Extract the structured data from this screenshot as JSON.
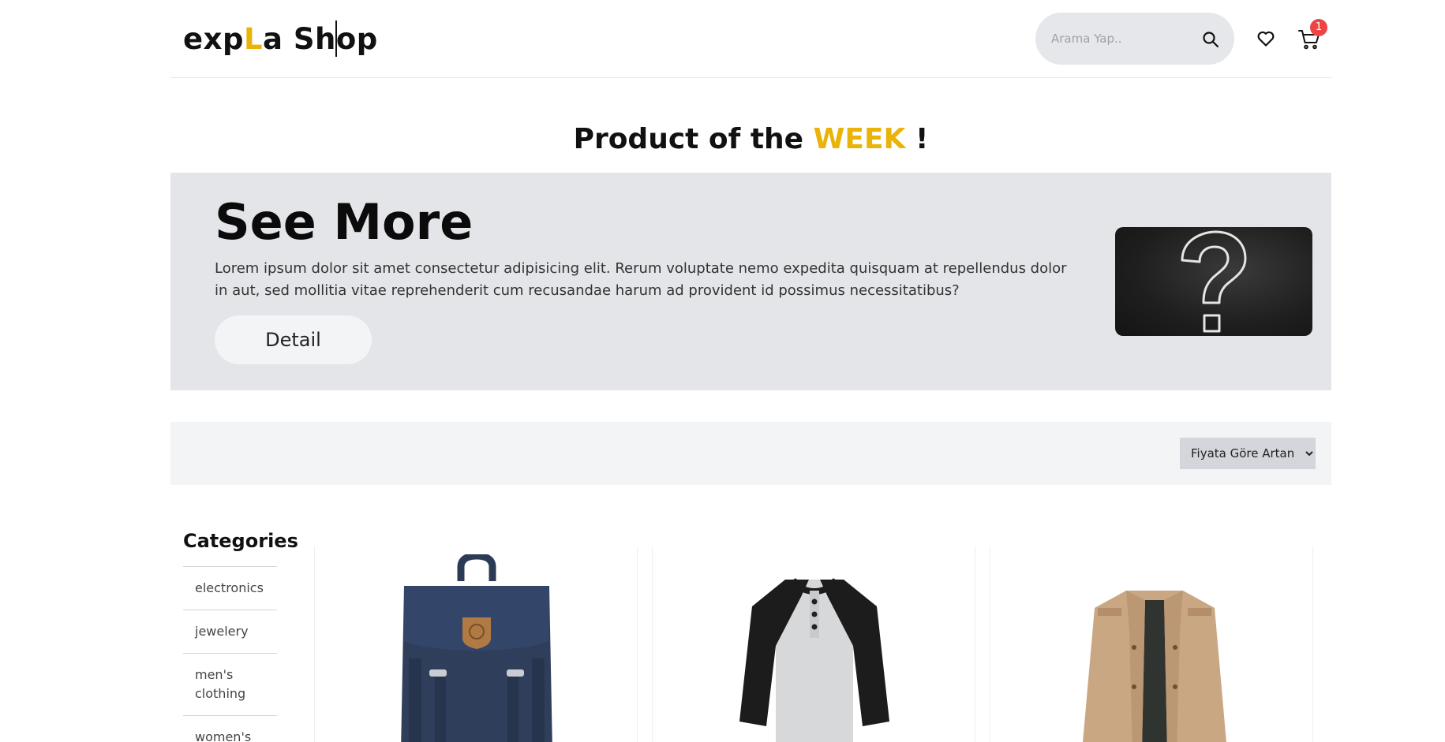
{
  "header": {
    "logo": {
      "part1": "exp",
      "accent": "L",
      "part2": "a Sh",
      "part3": "op"
    },
    "search": {
      "placeholder": "Arama Yap.."
    },
    "cart": {
      "count": "1"
    },
    "colors": {
      "accent": "#eab308",
      "badge": "#ef4444"
    }
  },
  "featured": {
    "title_prefix": "Product of the",
    "title_highlight": "WEEK",
    "title_suffix": "!",
    "heading": "See More",
    "description": "Lorem ipsum dolor sit amet consectetur adipisicing elit. Rerum voluptate nemo expedita quisquam at repellendus dolor in aut, sed mollitia vitae reprehenderit cum recusandae harum ad provident id possimus necessitatibus?",
    "button_label": "Detail"
  },
  "filter": {
    "sort_selected": "Fiyata Göre Artan"
  },
  "categories": {
    "title": "Categories",
    "items": [
      "electronics",
      "jewelery",
      "men's clothing",
      "women's clothing"
    ]
  },
  "products": [
    {
      "image": "navy-backpack"
    },
    {
      "image": "raglan-henley-shirt"
    },
    {
      "image": "khaki-jacket"
    }
  ]
}
